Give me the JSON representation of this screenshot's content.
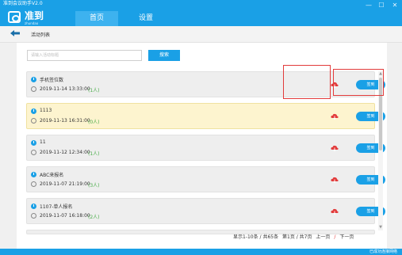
{
  "app": {
    "title": "准到会议助手V2.0",
    "logo_text": "准到",
    "logo_sub": "zhundao"
  },
  "window_controls": [
    "—",
    "☐",
    "✕"
  ],
  "nav": {
    "home_label": "首页",
    "settings_label": "设置"
  },
  "breadcrumb": {
    "label": "活动列表"
  },
  "search": {
    "placeholder": "请输入活动标题",
    "button_label": "搜索"
  },
  "colors": {
    "accent": "#1aa0e6",
    "highlight_row": "#fdf4cf",
    "count_text": "#4cae4c",
    "alert_red": "#e23b3b"
  },
  "activities": [
    {
      "name": "手机签位数",
      "time": "2019-11-14 13:33:00",
      "count": "(1人)",
      "signin_label": "签到"
    },
    {
      "name": "1113",
      "time": "2019-11-13 16:31:00",
      "count": "(0人)",
      "signin_label": "签到"
    },
    {
      "name": "11",
      "time": "2019-11-12 12:34:00",
      "count": "(1人)",
      "signin_label": "签到"
    },
    {
      "name": "ABC来报名",
      "time": "2019-11-07 21:19:00",
      "count": "(3人)",
      "signin_label": "签到"
    },
    {
      "name": "1107-单人报名",
      "time": "2019-11-07 16:18:00",
      "count": "(2人)",
      "signin_label": "签到"
    }
  ],
  "icons": {
    "back": "arrow-left-icon",
    "activity": "info-circle-icon",
    "time": "clock-icon",
    "download": "cloud-download-icon"
  },
  "pagination": {
    "summary": "显示1-10条 / 共65条",
    "page_info": "第1页 / 共7页",
    "prev_label": "上一页",
    "separator": "/",
    "next_label": "下一页"
  },
  "status": {
    "text": "已成功连接网络"
  }
}
